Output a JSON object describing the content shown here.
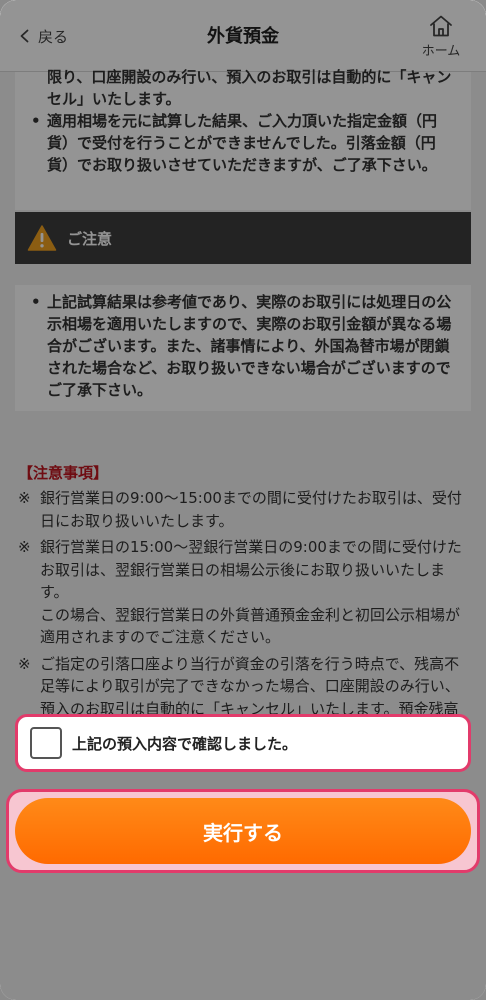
{
  "header": {
    "back_label": "戻る",
    "title": "外貨預金",
    "home_label": "ホーム"
  },
  "top_panel": {
    "items": [
      {
        "text": "限り、口座開設のみ行い、預入のお取引は自動的に「キャンセル」いたします。",
        "bullet": false
      },
      {
        "text": "適用相場を元に試算した結果、ご入力頂いた指定金額（円貨）で受付を行うことができませんでした。引落金額（円貨）でお取り扱いさせていただきますが、ご了承下さい。",
        "bullet": true
      }
    ]
  },
  "warning": {
    "label": "ご注意",
    "icon": "warning-triangle-icon",
    "icon_color": "#f0a020"
  },
  "bottom_panel": {
    "items": [
      {
        "text": "上記試算結果は参考値であり、実際のお取引には処理日の公示相場を適用いたしますので、実際のお取引金額が異なる場合がございます。また、諸事情により、外国為替市場が閉鎖された場合など、お取り扱いできない場合がございますのでご了承下さい。"
      }
    ]
  },
  "caution": {
    "title": "【注意事項】",
    "mark": "※",
    "notes": [
      {
        "text": "銀行営業日の9:00〜15:00までの間に受付けたお取引は、受付日にお取り扱いいたします。",
        "extra": ""
      },
      {
        "text": "銀行営業日の15:00〜翌銀行営業日の9:00までの間に受付けたお取引は、翌銀行営業日の相場公示後にお取り扱いいたします。",
        "extra": "この場合、翌銀行営業日の外貨普通預金金利と初回公示相場が適用されますのでご注意ください。"
      },
      {
        "text": "ご指定の引落口座より当行が資金の引落を行う時点で、残高不足等により取引が完了できなかった場合、口座開設のみ行い、預入のお取引は自動的に「キャンセル」いたします。預金残高をご確認のうえ、お申込みください。",
        "extra": ""
      }
    ]
  },
  "confirm": {
    "label": "上記の預入内容で確認しました。",
    "checked": false
  },
  "execute": {
    "label": "実行する",
    "color": "#ff7a0c"
  },
  "colors": {
    "highlight_border": "#e23b6b",
    "caution_title": "#c0151f"
  }
}
